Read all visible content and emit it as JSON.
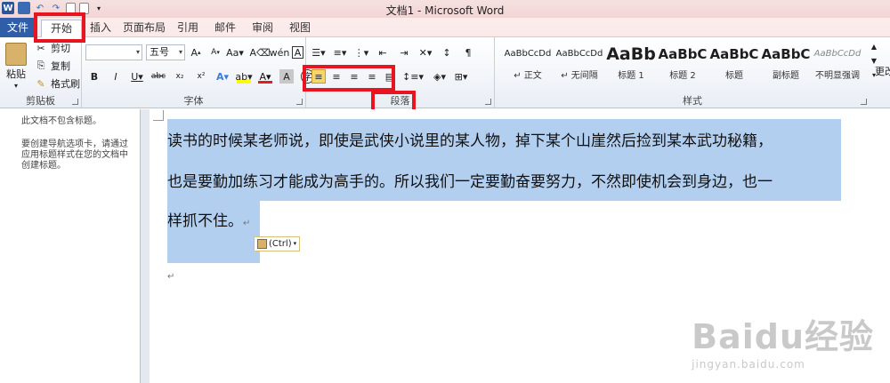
{
  "window": {
    "title": "文档1 - Microsoft Word"
  },
  "tabs": [
    {
      "label": "文件"
    },
    {
      "label": "开始"
    },
    {
      "label": "插入"
    },
    {
      "label": "页面布局"
    },
    {
      "label": "引用"
    },
    {
      "label": "邮件"
    },
    {
      "label": "审阅"
    },
    {
      "label": "视图"
    }
  ],
  "clipboard": {
    "paste": "粘贴",
    "cut": "剪切",
    "copy": "复制",
    "format_painter": "格式刷",
    "group_label": "剪贴板"
  },
  "font": {
    "name_value": "",
    "size_value": "五号",
    "group_label": "字体"
  },
  "paragraph": {
    "group_label": "段落"
  },
  "styles": {
    "group_label": "样式",
    "items": [
      {
        "preview": "AaBbCcDd",
        "name": "↵ 正文"
      },
      {
        "preview": "AaBbCcDd",
        "name": "↵ 无间隔"
      },
      {
        "preview": "AaBb",
        "name": "标题 1"
      },
      {
        "preview": "AaBbC",
        "name": "标题 2"
      },
      {
        "preview": "AaBbC",
        "name": "标题"
      },
      {
        "preview": "AaBbC",
        "name": "副标题"
      },
      {
        "preview": "AaBbCcDd",
        "name": "不明显强调"
      }
    ],
    "change_label": "更改"
  },
  "nav_pane": {
    "line1": "此文档不包含标题。",
    "line2": "要创建导航选项卡，请通过应用标题样式在您的文档中创建标题。"
  },
  "document": {
    "line1": "读书的时候某老师说，即使是武侠小说里的某人物，掉下某个山崖然后捡到某本武功秘籍，",
    "line2": "也是要勤加练习才能成为高手的。所以我们一定要勤奋要努力，不然即使机会到身边，也一",
    "line3": "样抓不住。",
    "paste_options": "(Ctrl)"
  },
  "watermark": {
    "logo": "Baidu经验",
    "url": "jingyan.baidu.com"
  },
  "colors": {
    "highlight_box": "#e8141f",
    "selection": "#b3cfef",
    "file_tab": "#2f5da8"
  }
}
